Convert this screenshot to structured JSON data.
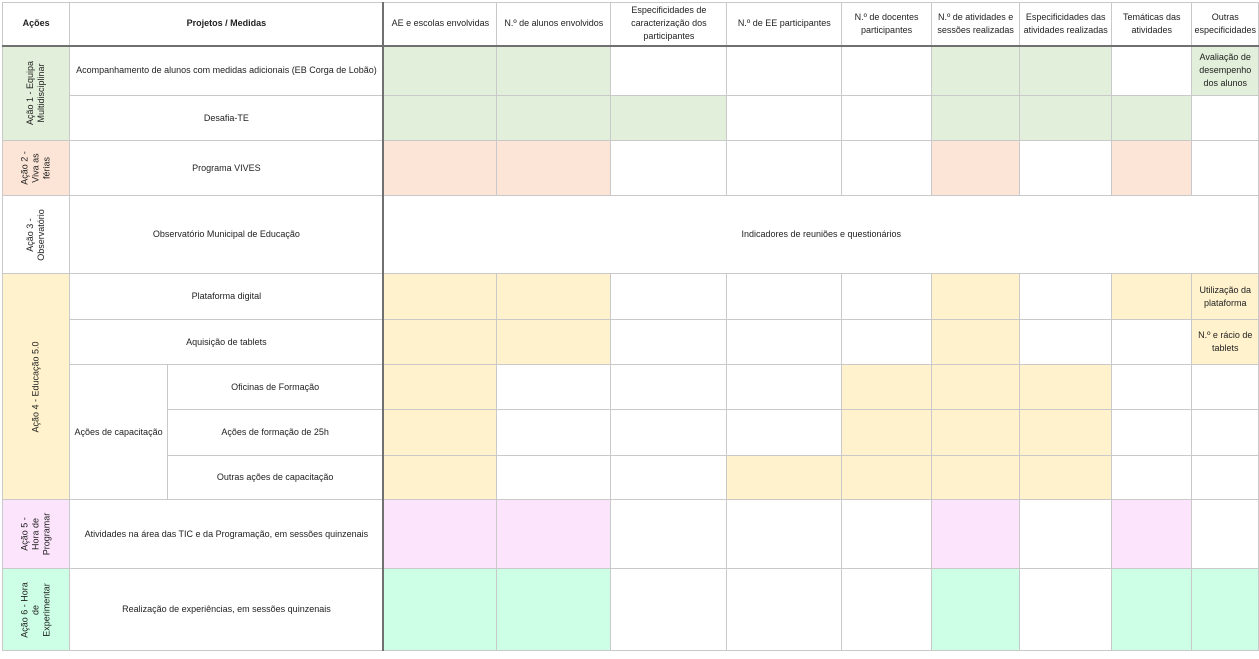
{
  "colors": {
    "green": "#e2efda",
    "salmon": "#fce4d6",
    "yellow": "#fff2cc",
    "pink": "#fce4fc",
    "mint": "#ccffe6",
    "white": "#ffffff"
  },
  "headers": {
    "acoes": "Ações",
    "projetos": "Projetos / Medidas",
    "columns": [
      "AE e escolas envolvidas",
      "N.º de alunos envolvidos",
      "Especificidades de caracterização dos participantes",
      "N.º de EE participantes",
      "N.º de docentes participantes",
      "N.º de atividades e sessões realizadas",
      "Especificidades das atividades realizadas",
      "Temáticas das atividades",
      "Outras especificidades"
    ]
  },
  "acoes": [
    {
      "label": "Ação 1 - Equipa Multidisciplinar",
      "color": "green"
    },
    {
      "label": "Ação 2 - Viva as férias",
      "color": "salmon"
    },
    {
      "label": "Ação 3 - Observatório",
      "color": "white"
    },
    {
      "label": "Ação 4 - Educação 5.0",
      "color": "yellow"
    },
    {
      "label": "Ação 5 - Hora de Programar",
      "color": "pink"
    },
    {
      "label": "Ação 6 - Hora de Experimentar",
      "color": "mint"
    }
  ],
  "rows": [
    {
      "project": "Acompanhamento de alunos com medidas adicionais (EB Corga de Lobão)",
      "cells": [
        "green",
        "green",
        "white",
        "white",
        "white",
        "green",
        "green",
        "white",
        "green"
      ],
      "texts": {
        "8": "Avaliação de desempenho dos alunos"
      }
    },
    {
      "project": "Desafia-TE",
      "cells": [
        "green",
        "green",
        "green",
        "white",
        "white",
        "green",
        "green",
        "green",
        "white"
      ],
      "texts": {}
    },
    {
      "project": "Programa VIVES",
      "cells": [
        "salmon",
        "salmon",
        "white",
        "white",
        "white",
        "salmon",
        "white",
        "salmon",
        "white"
      ],
      "texts": {}
    },
    {
      "project": "Observatório Municipal de Educação",
      "span_text": "Indicadores de reuniões e questionários"
    },
    {
      "project": "Plataforma digital",
      "cells": [
        "yellow",
        "yellow",
        "white",
        "white",
        "white",
        "yellow",
        "white",
        "yellow",
        "yellow"
      ],
      "texts": {
        "8": "Utilização da plataforma"
      }
    },
    {
      "project": "Aquisição de tablets",
      "cells": [
        "yellow",
        "yellow",
        "white",
        "white",
        "white",
        "yellow",
        "white",
        "white",
        "yellow"
      ],
      "texts": {
        "8": "N.º e rácio de tablets"
      }
    },
    {
      "group": "Ações de capacitação",
      "project": "Oficinas de Formação",
      "cells": [
        "yellow",
        "white",
        "white",
        "white",
        "yellow",
        "yellow",
        "yellow",
        "white",
        "white"
      ],
      "texts": {}
    },
    {
      "project": "Ações de formação de 25h",
      "cells": [
        "yellow",
        "white",
        "white",
        "white",
        "yellow",
        "yellow",
        "yellow",
        "white",
        "white"
      ],
      "texts": {}
    },
    {
      "project": "Outras ações de capacitação",
      "cells": [
        "yellow",
        "white",
        "white",
        "yellow",
        "yellow",
        "yellow",
        "yellow",
        "white",
        "white"
      ],
      "texts": {}
    },
    {
      "project": "Atividades na área das TIC e da Programação, em sessões quinzenais",
      "cells": [
        "pink",
        "pink",
        "white",
        "white",
        "white",
        "pink",
        "white",
        "pink",
        "white"
      ],
      "texts": {}
    },
    {
      "project": "Realização de experiências, em sessões quinzenais",
      "cells": [
        "mint",
        "mint",
        "white",
        "white",
        "white",
        "mint",
        "white",
        "mint",
        "mint"
      ],
      "texts": {}
    }
  ]
}
